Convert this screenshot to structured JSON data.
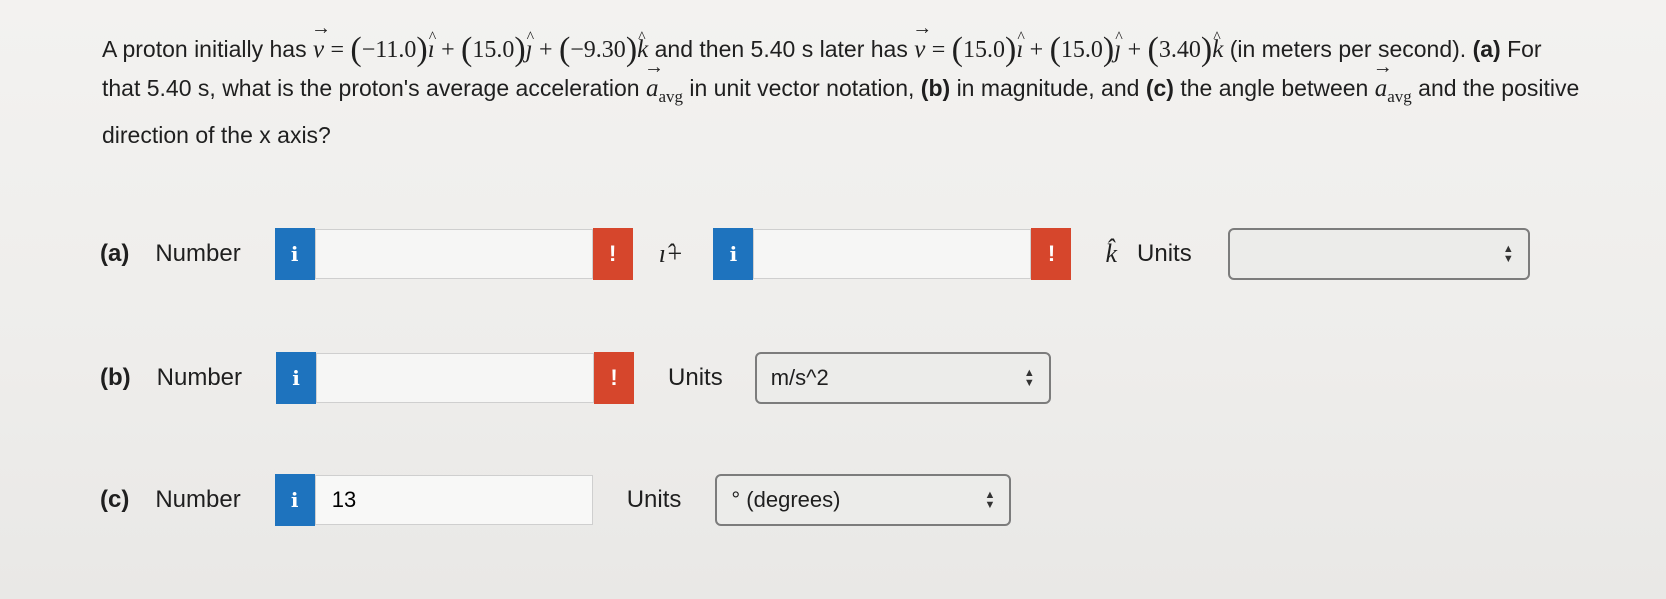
{
  "question": {
    "p1": "A proton initially has",
    "v": "v",
    "eq": "=",
    "v1x": "−11.0",
    "v1y": "15.0",
    "v1z": "−9.30",
    "i": "ı",
    "j": "ȷ",
    "k": "k",
    "plus": "+",
    "p2": "and then 5.40 s later has",
    "v2x": "15.0",
    "v2y": "15.0",
    "v2z": "3.40",
    "p3": "(in meters per second).",
    "part_a_tag": "(a)",
    "p4": "For that 5.40 s, what is the proton's average acceleration",
    "a": "a",
    "avg": "avg",
    "p5": "in unit vector notation,",
    "part_b_tag": "(b)",
    "p6": "in magnitude, and",
    "part_c_tag": "(c)",
    "p7": "the angle between",
    "p8": "and the positive direction of the x axis?"
  },
  "answers": {
    "a": {
      "part": "(a)",
      "number_label": "Number",
      "value_i": "",
      "value_k": "",
      "i_suffix": "ı̂+",
      "k_symbol": "k̂",
      "units_label": "Units",
      "units_value": ""
    },
    "b": {
      "part": "(b)",
      "number_label": "Number",
      "value": "",
      "units_label": "Units",
      "units_value": "m/s^2"
    },
    "c": {
      "part": "(c)",
      "number_label": "Number",
      "value": "13",
      "units_label": "Units",
      "units_value": "° (degrees)"
    }
  },
  "icons": {
    "info": "i",
    "warning": "!"
  },
  "colors": {
    "info": "#1e73be",
    "warning": "#d6462c"
  }
}
